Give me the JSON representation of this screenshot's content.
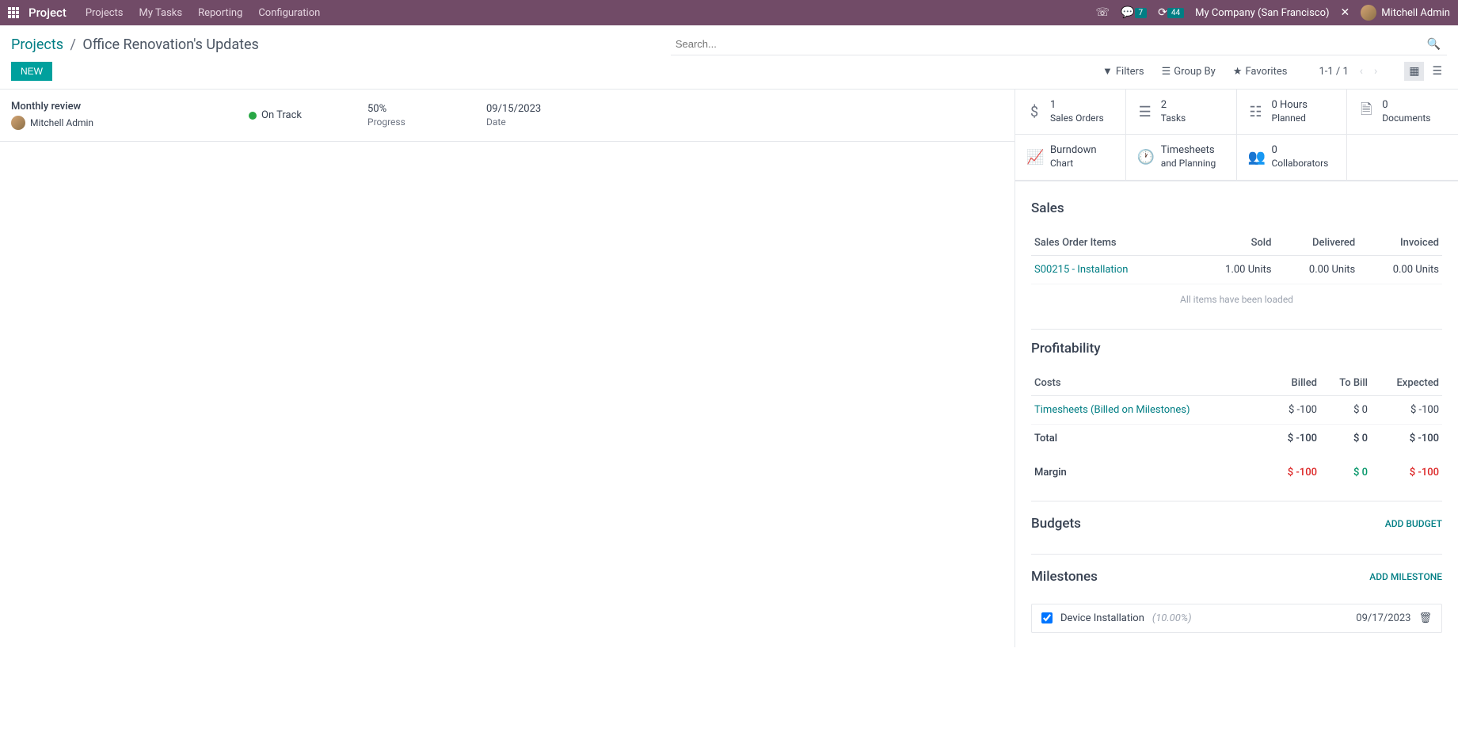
{
  "topbar": {
    "brand": "Project",
    "nav": [
      "Projects",
      "My Tasks",
      "Reporting",
      "Configuration"
    ],
    "message_badge": "7",
    "activity_badge": "44",
    "company": "My Company (San Francisco)",
    "username": "Mitchell Admin"
  },
  "breadcrumb": {
    "root": "Projects",
    "sep": "/",
    "current": "Office Renovation's Updates"
  },
  "search": {
    "placeholder": "Search..."
  },
  "controls": {
    "new_btn": "NEW",
    "filters": "Filters",
    "group_by": "Group By",
    "favorites": "Favorites",
    "pager": "1-1 / 1"
  },
  "update": {
    "title": "Monthly review",
    "author": "Mitchell Admin",
    "status": "On Track",
    "progress_value": "50%",
    "progress_label": "Progress",
    "date_value": "09/15/2023",
    "date_label": "Date"
  },
  "stat_cards": {
    "sales_orders": {
      "num": "1",
      "name": "Sales Orders"
    },
    "tasks": {
      "num": "2",
      "name": "Tasks"
    },
    "planned": {
      "num": "0 Hours",
      "name": "Planned"
    },
    "documents": {
      "num": "0",
      "name": "Documents"
    },
    "burndown": {
      "num": "Burndown",
      "name": "Chart"
    },
    "timesheets": {
      "num": "Timesheets",
      "name": "and Planning"
    },
    "collaborators": {
      "num": "0",
      "name": "Collaborators"
    }
  },
  "sales": {
    "title": "Sales",
    "headers": {
      "item": "Sales Order Items",
      "sold": "Sold",
      "delivered": "Delivered",
      "invoiced": "Invoiced"
    },
    "row": {
      "item": "S00215 - Installation",
      "sold": "1.00 Units",
      "delivered": "0.00 Units",
      "invoiced": "0.00 Units"
    },
    "loaded_msg": "All items have been loaded"
  },
  "profitability": {
    "title": "Profitability",
    "headers": {
      "costs": "Costs",
      "billed": "Billed",
      "to_bill": "To Bill",
      "expected": "Expected"
    },
    "row": {
      "name": "Timesheets (Billed on Milestones)",
      "billed": "$ -100",
      "to_bill": "$ 0",
      "expected": "$ -100"
    },
    "total": {
      "label": "Total",
      "billed": "$ -100",
      "to_bill": "$ 0",
      "expected": "$ -100"
    },
    "margin": {
      "label": "Margin",
      "billed": "$ -100",
      "to_bill": "$ 0",
      "expected": "$ -100"
    }
  },
  "budgets": {
    "title": "Budgets",
    "add": "ADD BUDGET"
  },
  "milestones": {
    "title": "Milestones",
    "add": "ADD MILESTONE",
    "row": {
      "name": "Device Installation",
      "pct": "(10.00%)",
      "date": "09/17/2023"
    }
  }
}
